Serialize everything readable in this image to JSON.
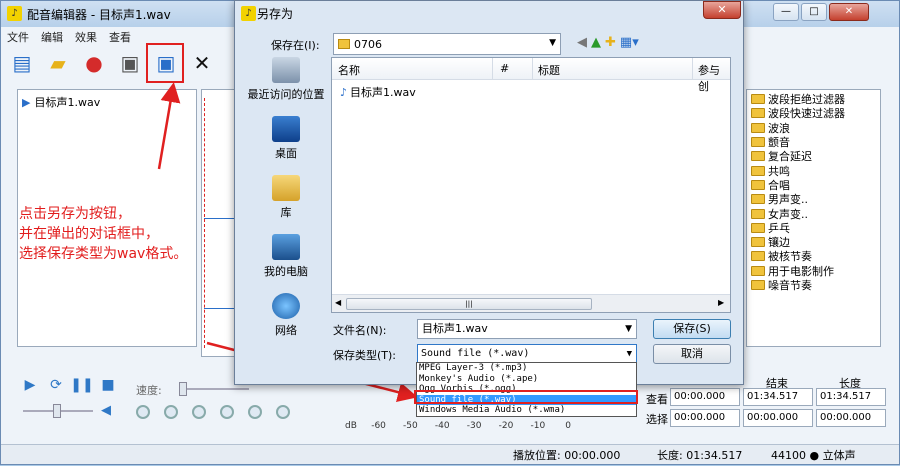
{
  "main": {
    "title": "配音编辑器 - 目标声1.wav",
    "menu": [
      "文件",
      "编辑",
      "效果",
      "查看"
    ],
    "file_item": "目标声1.wav",
    "effects": [
      "波段拒绝过滤器",
      "波段快速过滤器",
      "波浪",
      "颤音",
      "复合延迟",
      "共鸣",
      "合唱",
      "男声变..",
      "女声变..",
      "乒乓",
      "镶边",
      "被核节奏",
      "用于电影制作",
      "噪音节奏"
    ],
    "speed_label": "速度:",
    "fields": {
      "header_end": "结束",
      "header_length": "长度",
      "view_label": "查看",
      "select_label": "选择",
      "view_start": "00:00.000",
      "view_end": "01:34.517",
      "view_length": "01:34.517",
      "sel_start": "00:00.000",
      "sel_end": "00:00.000",
      "sel_length": "00:00.000"
    },
    "db_scale": "dB     -60      -50      -40      -30      -20      -10       0",
    "status": {
      "position": "播放位置: 00:00.000",
      "length": "长度: 01:34.517",
      "format": "44100 ● 立体声"
    }
  },
  "instruction": {
    "line1": "点击另存为按钮，",
    "line2": "并在弹出的对话框中，",
    "line3": "选择保存类型为wav格式。"
  },
  "dialog": {
    "title": "另存为",
    "close": "✕",
    "save_in_label": "保存在(I):",
    "save_in_value": "0706",
    "places": [
      "最近访问的位置",
      "桌面",
      "库",
      "我的电脑",
      "网络"
    ],
    "columns": [
      "名称",
      "#",
      "标题",
      "参与创"
    ],
    "files": [
      "目标声1.wav"
    ],
    "filename_label": "文件名(N):",
    "filename_value": "目标声1.wav",
    "filetype_label": "保存类型(T):",
    "filetype_value": "Sound file (*.wav)",
    "save_button": "保存(S)",
    "cancel_button": "取消",
    "filetype_options": [
      "MPEG Layer-3 (*.mp3)",
      "Monkey's Audio (*.ape)",
      "Ogg Vorbis (*.ogg)",
      "Sound file (*.wav)",
      "Windows Media Audio (*.wma)"
    ],
    "selected_option_index": 3
  },
  "colors": {
    "highlight": "#e02020",
    "instruction": "#e21d1d",
    "selection": "#3399ff"
  }
}
